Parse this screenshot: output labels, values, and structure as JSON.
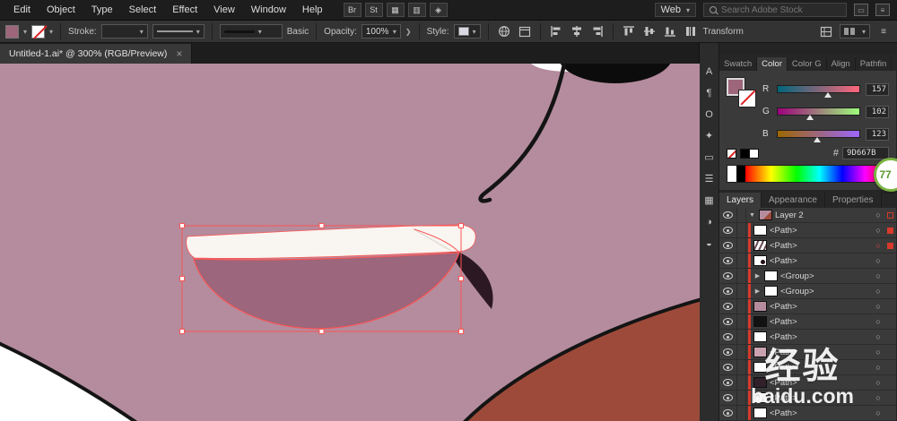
{
  "menubar": {
    "items": [
      "Edit",
      "Object",
      "Type",
      "Select",
      "Effect",
      "View",
      "Window",
      "Help"
    ],
    "tool_buttons": [
      "Br",
      "St"
    ],
    "workspace": "Web",
    "search_placeholder": "Search Adobe Stock"
  },
  "controlbar": {
    "stroke_label": "Stroke:",
    "brush_name": "Basic",
    "opacity_label": "Opacity:",
    "opacity_value": "100%",
    "style_label": "Style:",
    "transform_label": "Transform"
  },
  "tabbar": {
    "document_title": "Untitled-1.ai* @ 300% (RGB/Preview)",
    "close_glyph": "×"
  },
  "dock_icons": [
    {
      "name": "character-icon",
      "glyph": "A"
    },
    {
      "name": "paragraph-icon",
      "glyph": "¶"
    },
    {
      "name": "opentype-icon",
      "glyph": "O"
    },
    {
      "name": "symbols-icon",
      "glyph": "✦"
    },
    {
      "name": "artboards-icon",
      "glyph": "▭"
    },
    {
      "name": "appearance-icon",
      "glyph": "☰"
    },
    {
      "name": "swatches-icon",
      "glyph": "▦"
    },
    {
      "name": "transparency-icon",
      "glyph": "◑"
    },
    {
      "name": "gradient-icon",
      "glyph": "◒"
    }
  ],
  "panels": {
    "top_tabs": [
      "Swatch",
      "Color",
      "Color G",
      "Align",
      "Pathfin"
    ],
    "color": {
      "channels": [
        {
          "label": "R",
          "value": 157
        },
        {
          "label": "G",
          "value": 102
        },
        {
          "label": "B",
          "value": 123
        }
      ],
      "hex_label": "#",
      "hex_value": "9D667B"
    },
    "mid_tabs": [
      "Layers",
      "Appearance",
      "Properties"
    ],
    "layer_rows": [
      {
        "name": "Layer 2",
        "kind": "layer"
      },
      {
        "name": "<Path>",
        "kind": "path"
      },
      {
        "name": "<Path>",
        "kind": "path"
      },
      {
        "name": "<Path>",
        "kind": "path"
      },
      {
        "name": "<Group>",
        "kind": "group"
      },
      {
        "name": "<Group>",
        "kind": "group"
      },
      {
        "name": "<Path>",
        "kind": "path"
      },
      {
        "name": "<Path>",
        "kind": "path"
      },
      {
        "name": "<Path>",
        "kind": "path"
      },
      {
        "name": "<Path>",
        "kind": "path"
      },
      {
        "name": "<Path>",
        "kind": "path"
      },
      {
        "name": "<Path>",
        "kind": "path"
      },
      {
        "name": "<Path>",
        "kind": "path"
      },
      {
        "name": "<Path>",
        "kind": "path"
      }
    ]
  },
  "badge": {
    "value": "77"
  },
  "watermark": {
    "line1": "经验",
    "line2": "baidu.com"
  },
  "colors": {
    "skin": "#b48c9d",
    "mouth": "#9c667c",
    "teeth": "#f9f5f1",
    "mouth_shadow": "#2c1822",
    "shoulder": "#9e4a3a",
    "outline": "#141414",
    "selection": "#fb5555",
    "layer_mark": "#d7392b",
    "fill_swatch": "#9d667b"
  }
}
